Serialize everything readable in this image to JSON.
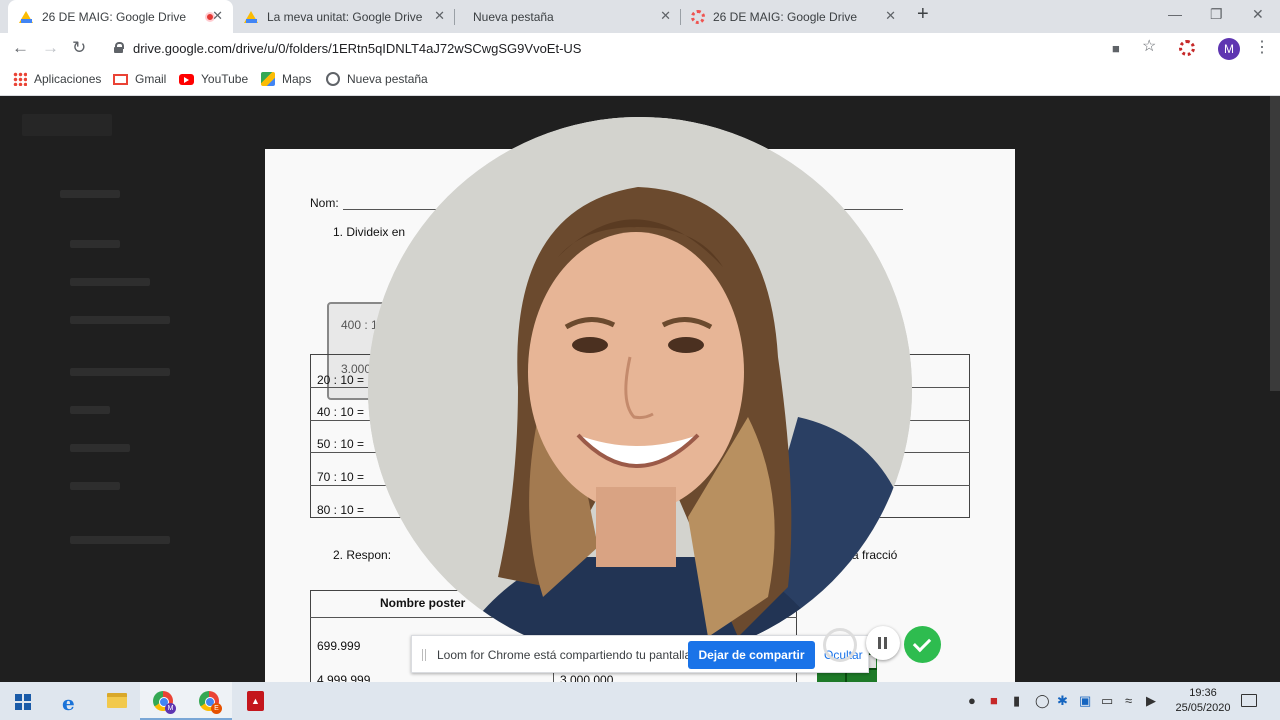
{
  "browser": {
    "tabs": [
      {
        "title": "26 DE MAIG: Google Drive",
        "icon": "google-drive-icon",
        "recording": true,
        "active": true
      },
      {
        "title": "La meva unitat: Google Drive",
        "icon": "google-drive-icon"
      },
      {
        "title": "Nueva pestaña",
        "icon": ""
      },
      {
        "title": "26 DE MAIG: Google Drive",
        "icon": "loom-icon"
      }
    ],
    "new_tab": "+",
    "close_glyph": "✕",
    "url": "drive.google.com/drive/u/0/folders/1ERtn5qIDNLT4aJ72wSCwgSG9VvoEt-US",
    "profile_initial": "M",
    "profile_color": "#5e35b1",
    "bookmarks": [
      "Aplicaciones",
      "Gmail",
      "YouTube",
      "Maps",
      "Nueva pestaña"
    ]
  },
  "document": {
    "name_label": "Nom:",
    "q1": "1.   Divideix en",
    "box": [
      "400 : 10",
      "3.000"
    ],
    "rows": [
      "20 : 10 =",
      "40 : 10 =",
      "50 : 10 =",
      "70 : 10 =",
      "80 : 10 ="
    ],
    "q2_start": "2.   Respon:",
    "q2_end": "a fracció",
    "table2_header": "Nombre poster",
    "table2_rows": [
      "699.999",
      "4.999.999"
    ],
    "table2_value": "3.000.000"
  },
  "loom": {
    "message": "Loom for Chrome está compartiendo tu pantalla.",
    "stop_label": "Dejar de compartir",
    "hide_label": "Ocultar",
    "accent": "#1a73e8",
    "done_color": "#2ebc4f"
  },
  "taskbar": {
    "apps": [
      "windows-start-icon",
      "edge-icon",
      "file-explorer-icon",
      "chrome-icon",
      "chrome-icon",
      "acrobat-icon"
    ],
    "chrome_badges": [
      "M",
      "E"
    ],
    "time": "19:36",
    "date": "25/05/2020"
  }
}
